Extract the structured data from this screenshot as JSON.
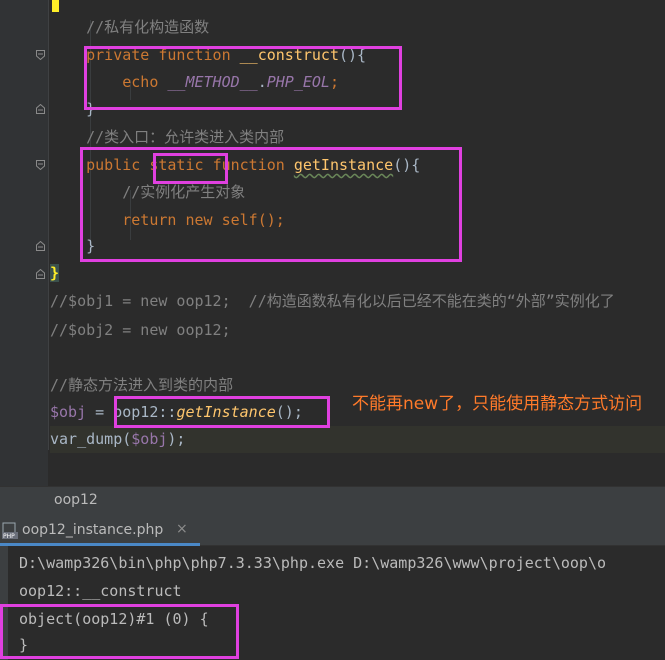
{
  "editor": {
    "lines": [
      {
        "text": "    //私有化构造函数"
      },
      {
        "indent": "    ",
        "kw1": "private",
        "kw2": " function ",
        "fn": "__construct",
        "rest": "(){"
      },
      {
        "indent": "        ",
        "kw": "echo",
        "const": " __METHOD__",
        "dot": ".",
        "const2": "PHP_EOL",
        "semi": ";"
      },
      {
        "text": "    }"
      },
      {
        "text": "    //类入口：允许类进入类内部"
      },
      {
        "indent": "    ",
        "kw1": "public",
        "kw2": "static",
        "kw3": "function",
        "fn": "getInstance",
        "rest": "(){"
      },
      {
        "text": "        //实例化产生对象"
      },
      {
        "indent": "        ",
        "kw1": "return",
        "kw2": " new ",
        "kw3": "self",
        "rest": "();"
      },
      {
        "text": "    }"
      },
      {
        "text": "}"
      },
      {
        "text": "//$obj1 = new oop12;  //构造函数私有化以后已经不能在类的“外部”实例化了"
      },
      {
        "text": "//$obj2 = new oop12;"
      },
      {
        "text": ""
      },
      {
        "text": "//静态方法进入到类的内部"
      },
      {
        "var": "$obj",
        "eq": " = ",
        "cls": "oop12::",
        "fn": "getInstance",
        "rest": "();"
      },
      {
        "fn": "var_dump",
        "open": "(",
        "var": "$obj",
        "close": ");"
      }
    ],
    "annotation": "不能再new了，只能使用静态方式访问"
  },
  "breadcrumb": {
    "item": "oop12"
  },
  "run_panel": {
    "tab_label": "oop12_instance.php",
    "close_glyph": "×",
    "output": [
      "D:\\wamp326\\bin\\php\\php7.3.33\\php.exe D:\\wamp326\\www\\project\\oop\\o",
      "oop12::__construct",
      "object(oop12)#1 (0) {",
      "}"
    ]
  },
  "colors": {
    "background": "#2b2b2b",
    "keyword": "#cc7832",
    "function": "#ffc66d",
    "variable": "#9876aa",
    "comment": "#808080",
    "highlight_box": "#e040e0",
    "annotation_text": "#ff7a2a"
  }
}
